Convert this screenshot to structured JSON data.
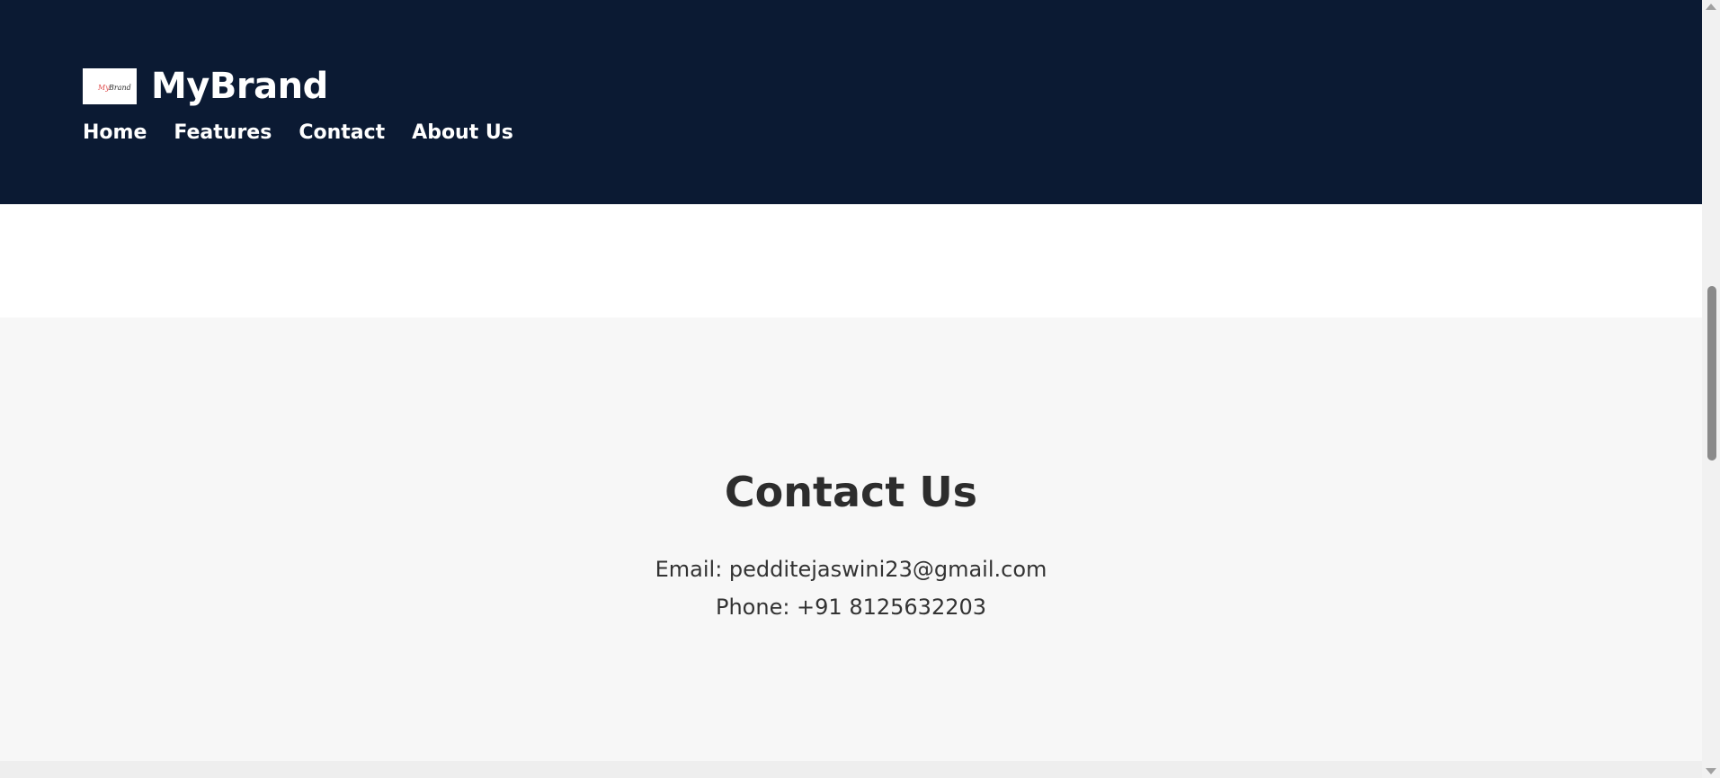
{
  "header": {
    "brand_name": "MyBrand",
    "logo_icon": "brand-logo-image",
    "logo_text": "My Brand",
    "background_color": "#0b1a33"
  },
  "nav": {
    "items": [
      {
        "label": "Home"
      },
      {
        "label": "Features"
      },
      {
        "label": "Contact"
      },
      {
        "label": "About Us"
      }
    ]
  },
  "contact": {
    "title": "Contact Us",
    "email_line": "Email: pedditejaswini23@gmail.com",
    "phone_line": "Phone: +91 8125632203",
    "background_color": "#f7f7f7"
  },
  "scrollbar": {
    "thumb_color": "#8a8a8a"
  }
}
